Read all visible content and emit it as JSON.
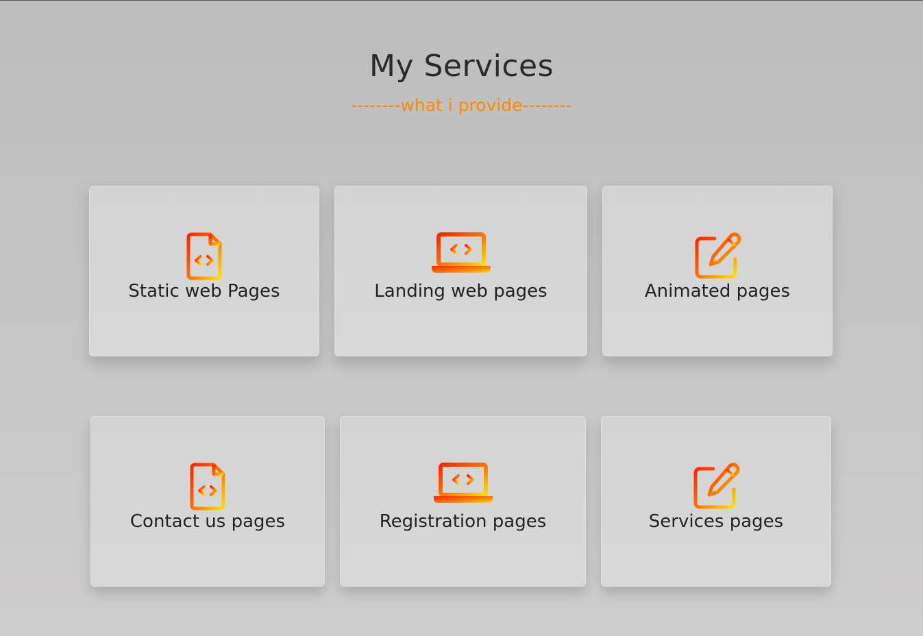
{
  "header": {
    "title": "My Services",
    "subtitle": "--------what i provide--------"
  },
  "colors": {
    "accent": "#ff8a00",
    "icon_gradient_start": "#ff2a00",
    "icon_gradient_end": "#ffd200"
  },
  "services": [
    {
      "label": "Static web Pages",
      "icon": "code-file-icon"
    },
    {
      "label": "Landing web pages",
      "icon": "laptop-code-icon"
    },
    {
      "label": "Animated pages",
      "icon": "edit-icon"
    },
    {
      "label": "Contact us pages",
      "icon": "code-file-icon"
    },
    {
      "label": "Registration pages",
      "icon": "laptop-code-icon"
    },
    {
      "label": "Services pages",
      "icon": "edit-icon"
    }
  ]
}
